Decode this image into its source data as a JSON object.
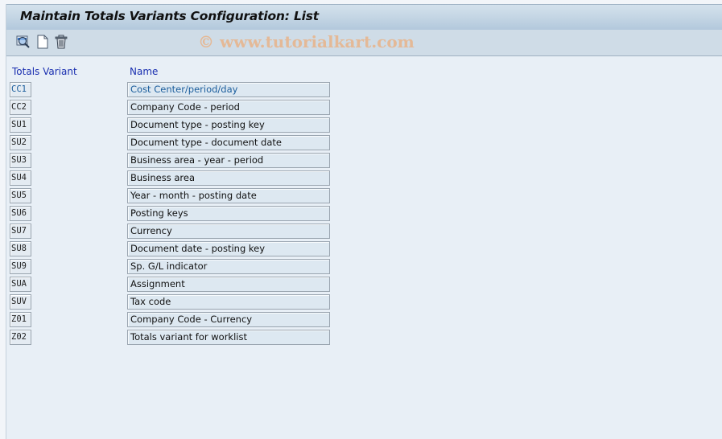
{
  "window": {
    "title": "Maintain Totals Variants Configuration: List"
  },
  "toolbar": {
    "buttons": [
      {
        "name": "display-detail-button",
        "icon": "magnifier-detail-icon"
      },
      {
        "name": "new-entries-button",
        "icon": "new-document-icon"
      },
      {
        "name": "delete-button",
        "icon": "trash-icon"
      }
    ],
    "watermark": "© www.tutorialkart.com"
  },
  "table": {
    "columns": [
      "Totals Variant",
      "Name"
    ],
    "rows": [
      {
        "code": "CC1",
        "name": "Cost Center/period/day",
        "selected": true
      },
      {
        "code": "CC2",
        "name": "Company Code - period"
      },
      {
        "code": "SU1",
        "name": "Document type - posting key"
      },
      {
        "code": "SU2",
        "name": "Document type - document date"
      },
      {
        "code": "SU3",
        "name": "Business area - year - period"
      },
      {
        "code": "SU4",
        "name": "Business area"
      },
      {
        "code": "SU5",
        "name": "Year - month - posting date"
      },
      {
        "code": "SU6",
        "name": "Posting keys"
      },
      {
        "code": "SU7",
        "name": "Currency"
      },
      {
        "code": "SU8",
        "name": "Document date - posting key"
      },
      {
        "code": "SU9",
        "name": "Sp. G/L indicator"
      },
      {
        "code": "SUA",
        "name": "Assignment"
      },
      {
        "code": "SUV",
        "name": "Tax code"
      },
      {
        "code": "Z01",
        "name": "Company Code - Currency"
      },
      {
        "code": "Z02",
        "name": "Totals variant for worklist"
      }
    ]
  }
}
